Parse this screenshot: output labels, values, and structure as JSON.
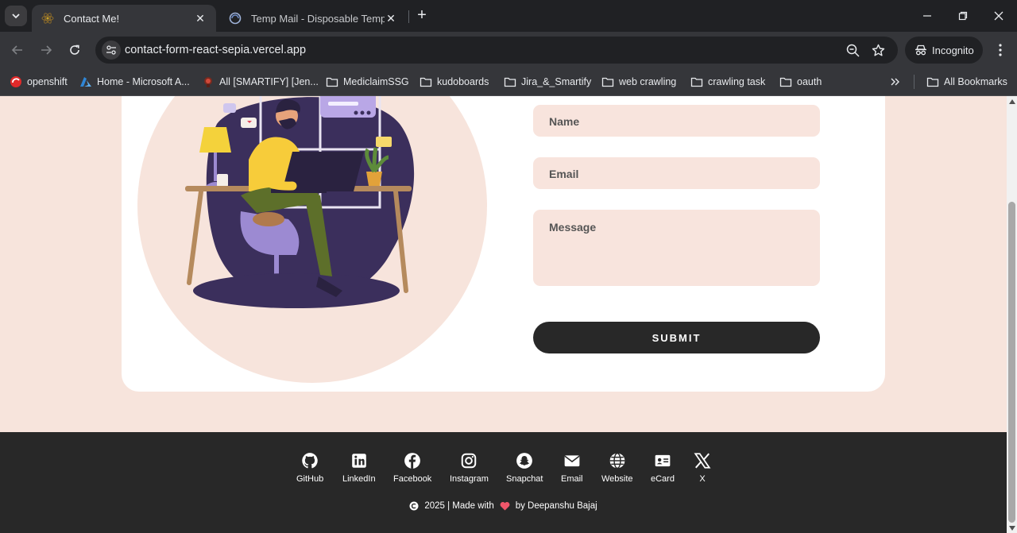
{
  "browser": {
    "tabs": [
      {
        "title": "Contact Me!",
        "active": true,
        "favicon": "react-favicon-icon"
      },
      {
        "title": "Temp Mail - Disposable Tempor",
        "active": false,
        "favicon": "tempmail-favicon-icon"
      }
    ],
    "url": "contact-form-react-sepia.vercel.app",
    "incognito_label": "Incognito",
    "bookmarks": [
      {
        "label": "openshift",
        "icon": "openshift-icon"
      },
      {
        "label": "Home - Microsoft A...",
        "icon": "azure-icon"
      },
      {
        "label": "All [SMARTIFY] [Jen...",
        "icon": "jenkins-icon"
      },
      {
        "label": "MediclaimSSG",
        "icon": "folder-icon"
      },
      {
        "label": "kudoboards",
        "icon": "folder-icon"
      },
      {
        "label": "Jira_&_Smartify",
        "icon": "folder-icon"
      },
      {
        "label": "web crawling",
        "icon": "folder-icon"
      },
      {
        "label": "crawling task",
        "icon": "folder-icon"
      },
      {
        "label": "oauth",
        "icon": "folder-icon"
      }
    ],
    "all_bookmarks_label": "All Bookmarks"
  },
  "form": {
    "name_placeholder": "Name",
    "email_placeholder": "Email",
    "message_placeholder": "Message",
    "submit_label": "SUBMIT"
  },
  "footer": {
    "links": [
      {
        "label": "GitHub",
        "icon": "github-icon"
      },
      {
        "label": "LinkedIn",
        "icon": "linkedin-icon"
      },
      {
        "label": "Facebook",
        "icon": "facebook-icon"
      },
      {
        "label": "Instagram",
        "icon": "instagram-icon"
      },
      {
        "label": "Snapchat",
        "icon": "snapchat-icon"
      },
      {
        "label": "Email",
        "icon": "envelope-icon"
      },
      {
        "label": "Website",
        "icon": "globe-icon"
      },
      {
        "label": "eCard",
        "icon": "id-card-icon"
      },
      {
        "label": "X",
        "icon": "x-logo-icon"
      }
    ],
    "credit_year": "2025 | Made with",
    "credit_by": "by Deepanshu Bajaj"
  },
  "colors": {
    "page_bg": "#f7e4dc",
    "card_bg": "#ffffff",
    "field_bg": "#f8e4dd",
    "dark": "#282828",
    "heart": "#f0566a"
  }
}
